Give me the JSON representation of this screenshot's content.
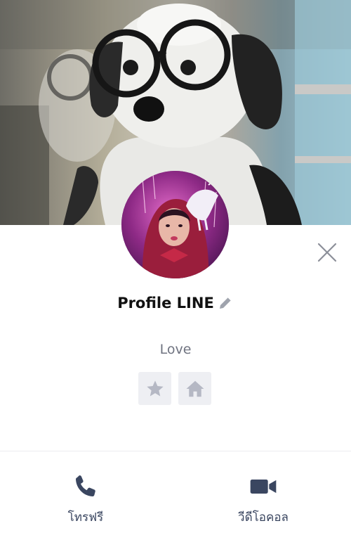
{
  "profile": {
    "name": "Profile LINE",
    "status_message": "Love"
  },
  "icons": {
    "close": "close-icon",
    "edit": "pencil-icon",
    "favorite": "star-icon",
    "home": "home-icon",
    "call": "phone-icon",
    "video": "video-camera-icon"
  },
  "actions": {
    "free_call_label": "โทรฟรี",
    "video_call_label": "วีดีโอคอล"
  },
  "colors": {
    "action_icon": "#3a4660",
    "tile_background": "#eeeff3",
    "tile_icon": "#b5b8c4",
    "name_text": "#111111",
    "status_text": "#6f7380"
  }
}
